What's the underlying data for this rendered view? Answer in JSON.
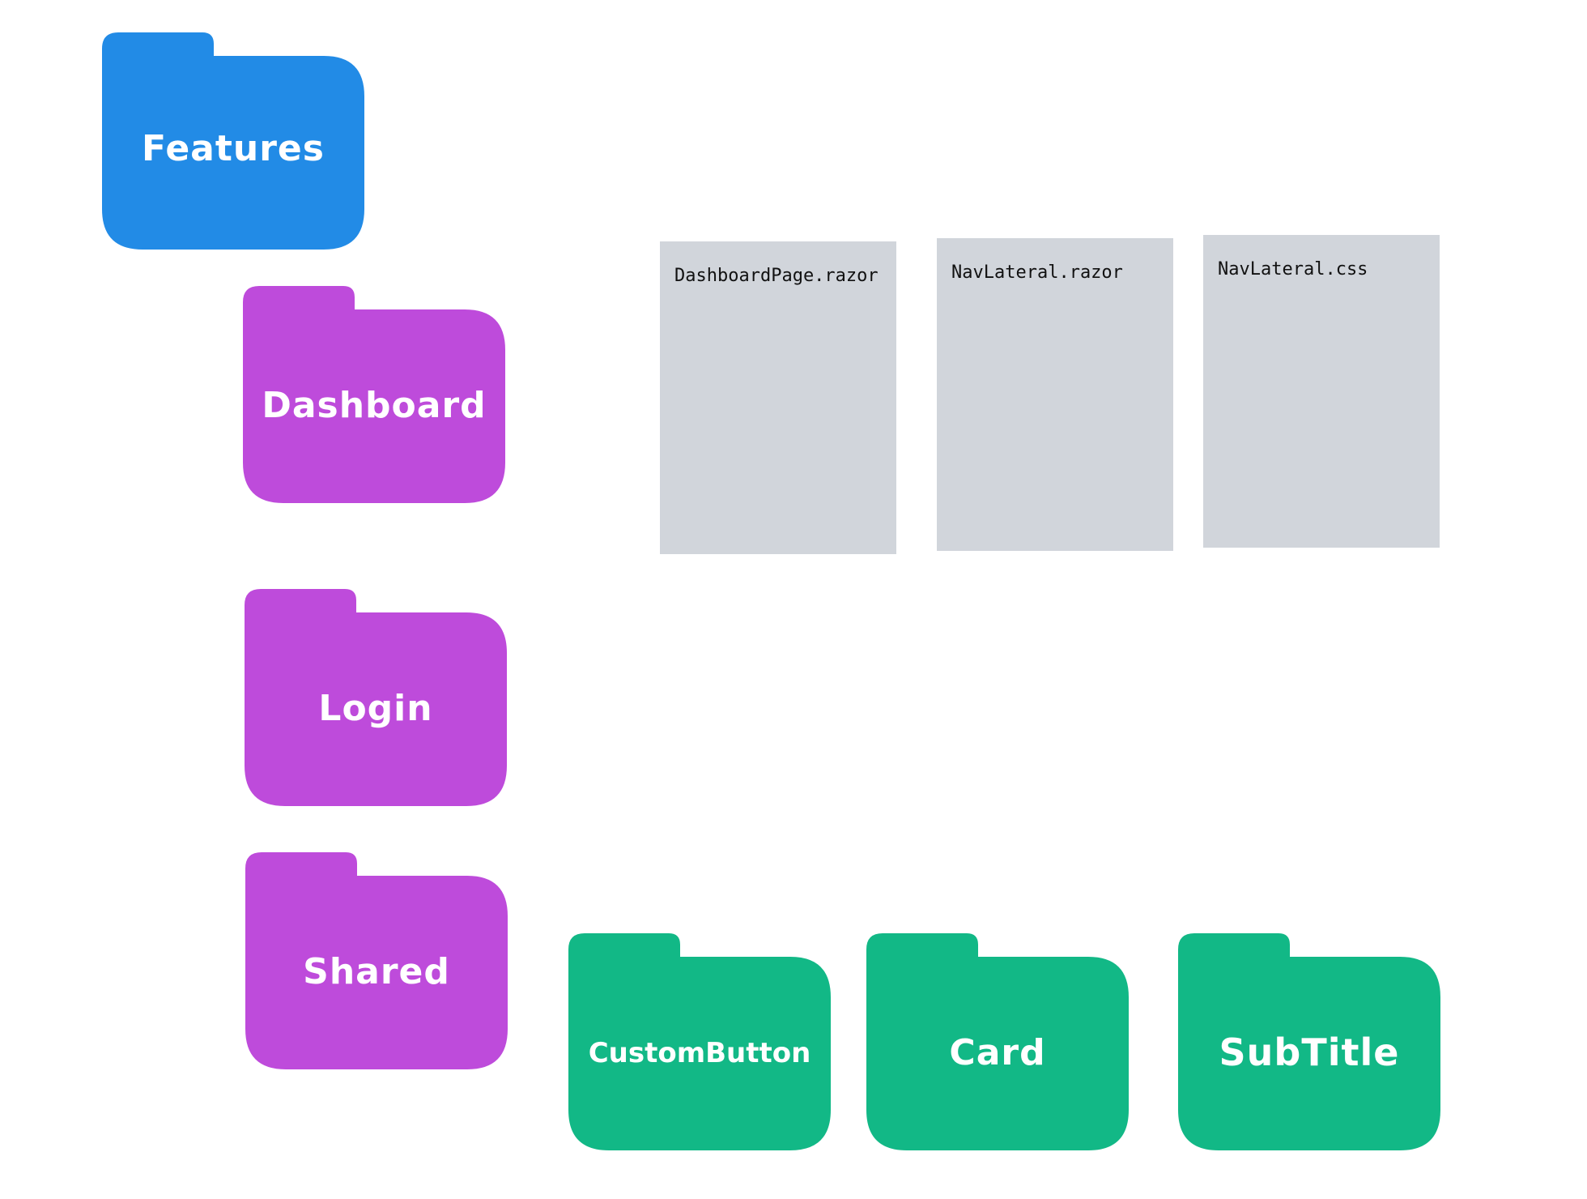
{
  "colors": {
    "root_folder": "#228be6",
    "feature_folder": "#be4bdb",
    "component_folder": "#12b886",
    "file_card": "#d1d5db",
    "folder_text": "#ffffff",
    "file_text": "#111111"
  },
  "folders": {
    "features": "Features",
    "dashboard": "Dashboard",
    "login": "Login",
    "shared": "Shared",
    "custom_button": "CustomButton",
    "card": "Card",
    "subtitle": "SubTitle"
  },
  "files": {
    "dashboard_page": "DashboardPage.razor",
    "nav_lateral_razor": "NavLateral.razor",
    "nav_lateral_css": "NavLateral.css"
  }
}
